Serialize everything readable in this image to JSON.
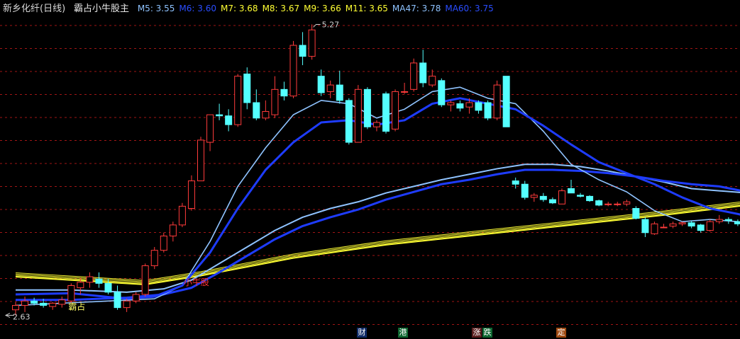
{
  "header": {
    "stock_title": "新乡化纤(日线)",
    "indicator_name": "霸占小牛股主",
    "ma_labels": [
      {
        "text": "M5: 3.55",
        "color": "#8fc3ff"
      },
      {
        "text": "M6: 3.60",
        "color": "#2a4dff"
      },
      {
        "text": "M7: 3.68",
        "color": "#ffff33"
      },
      {
        "text": "M8: 3.67",
        "color": "#ffff33"
      },
      {
        "text": "M9: 3.66",
        "color": "#ffff33"
      },
      {
        "text": "M11: 3.65",
        "color": "#ffff33"
      },
      {
        "text": "MA47: 3.78",
        "color": "#8fc3ff"
      },
      {
        "text": "MA60: 3.75",
        "color": "#2a4dff"
      }
    ]
  },
  "chart_data": {
    "type": "candlestick",
    "ylim": [
      2.55,
      5.35
    ],
    "high_label": "5.27",
    "low_label": "2.63",
    "annotations": [
      {
        "text": "霸占",
        "color": "#ffff66"
      },
      {
        "text": "小牛股",
        "color": "#ff3333"
      }
    ],
    "colors": {
      "up": "#ff3b3b",
      "down": "#54ffff",
      "ma_light": "#8fc3ff",
      "ma_dark": "#1e3cff",
      "ribbon": "#ffff33"
    },
    "candles": [
      [
        2.68,
        2.75,
        2.63,
        2.72
      ],
      [
        2.72,
        2.8,
        2.66,
        2.76
      ],
      [
        2.76,
        2.79,
        2.72,
        2.74
      ],
      [
        2.74,
        2.78,
        2.7,
        2.72
      ],
      [
        2.71,
        2.75,
        2.68,
        2.74
      ],
      [
        2.73,
        2.8,
        2.7,
        2.77
      ],
      [
        2.76,
        2.92,
        2.74,
        2.9
      ],
      [
        2.88,
        2.97,
        2.82,
        2.93
      ],
      [
        2.93,
        3.02,
        2.88,
        2.98
      ],
      [
        2.96,
        3.02,
        2.88,
        2.92
      ],
      [
        2.92,
        2.96,
        2.82,
        2.84
      ],
      [
        2.84,
        2.9,
        2.68,
        2.7
      ],
      [
        2.7,
        2.78,
        2.66,
        2.76
      ],
      [
        2.76,
        2.84,
        2.74,
        2.82
      ],
      [
        2.82,
        3.1,
        2.8,
        3.08
      ],
      [
        3.08,
        3.25,
        3.05,
        3.22
      ],
      [
        3.22,
        3.38,
        3.2,
        3.35
      ],
      [
        3.35,
        3.48,
        3.3,
        3.45
      ],
      [
        3.45,
        3.65,
        3.43,
        3.62
      ],
      [
        3.6,
        3.9,
        3.58,
        3.85
      ],
      [
        3.85,
        4.25,
        3.85,
        4.22
      ],
      [
        4.2,
        4.45,
        4.12,
        4.45
      ],
      [
        4.45,
        4.55,
        4.4,
        4.44
      ],
      [
        4.44,
        4.5,
        4.3,
        4.36
      ],
      [
        4.36,
        4.82,
        4.34,
        4.8
      ],
      [
        4.82,
        4.88,
        4.5,
        4.56
      ],
      [
        4.56,
        4.68,
        4.4,
        4.42
      ],
      [
        4.42,
        4.58,
        4.4,
        4.48
      ],
      [
        4.45,
        4.8,
        4.42,
        4.68
      ],
      [
        4.68,
        4.75,
        4.58,
        4.62
      ],
      [
        4.62,
        5.12,
        4.6,
        5.08
      ],
      [
        5.08,
        5.2,
        4.9,
        4.98
      ],
      [
        4.98,
        5.27,
        4.95,
        5.22
      ],
      [
        4.8,
        4.86,
        4.62,
        4.65
      ],
      [
        4.66,
        4.76,
        4.6,
        4.72
      ],
      [
        4.72,
        4.85,
        4.55,
        4.58
      ],
      [
        4.58,
        4.6,
        4.18,
        4.2
      ],
      [
        4.2,
        4.72,
        4.2,
        4.68
      ],
      [
        4.68,
        4.7,
        4.32,
        4.34
      ],
      [
        4.34,
        4.4,
        4.3,
        4.38
      ],
      [
        4.64,
        4.66,
        4.28,
        4.3
      ],
      [
        4.32,
        4.68,
        4.3,
        4.66
      ],
      [
        4.66,
        4.74,
        4.64,
        4.66
      ],
      [
        4.68,
        4.96,
        4.66,
        4.92
      ],
      [
        4.92,
        5.04,
        4.7,
        4.74
      ],
      [
        4.72,
        4.86,
        4.7,
        4.8
      ],
      [
        4.76,
        4.78,
        4.52,
        4.54
      ],
      [
        4.54,
        4.58,
        4.48,
        4.56
      ],
      [
        4.55,
        4.58,
        4.48,
        4.51
      ],
      [
        4.52,
        4.6,
        4.46,
        4.56
      ],
      [
        4.56,
        4.58,
        4.46,
        4.49
      ],
      [
        4.56,
        4.58,
        4.4,
        4.42
      ],
      [
        4.42,
        4.76,
        4.4,
        4.72
      ],
      [
        4.8,
        4.8,
        4.34,
        4.34
      ],
      [
        3.85,
        3.88,
        3.78,
        3.82
      ],
      [
        3.82,
        3.85,
        3.68,
        3.7
      ],
      [
        3.7,
        3.74,
        3.66,
        3.72
      ],
      [
        3.71,
        3.74,
        3.66,
        3.68
      ],
      [
        3.68,
        3.7,
        3.64,
        3.65
      ],
      [
        3.64,
        3.78,
        3.64,
        3.76
      ],
      [
        3.78,
        3.86,
        3.74,
        3.74
      ],
      [
        3.72,
        3.74,
        3.7,
        3.71
      ],
      [
        3.71,
        3.72,
        3.66,
        3.67
      ],
      [
        3.67,
        3.68,
        3.62,
        3.63
      ],
      [
        3.64,
        3.66,
        3.62,
        3.64
      ],
      [
        3.64,
        3.66,
        3.62,
        3.64
      ],
      [
        3.64,
        3.68,
        3.62,
        3.66
      ],
      [
        3.6,
        3.62,
        3.5,
        3.51
      ],
      [
        3.5,
        3.52,
        3.34,
        3.38
      ],
      [
        3.37,
        3.48,
        3.36,
        3.46
      ],
      [
        3.43,
        3.46,
        3.42,
        3.43
      ],
      [
        3.44,
        3.48,
        3.42,
        3.46
      ],
      [
        3.46,
        3.48,
        3.44,
        3.47
      ],
      [
        3.47,
        3.49,
        3.42,
        3.44
      ],
      [
        3.45,
        3.46,
        3.38,
        3.4
      ],
      [
        3.4,
        3.5,
        3.39,
        3.48
      ],
      [
        3.48,
        3.54,
        3.46,
        3.5
      ],
      [
        3.5,
        3.52,
        3.46,
        3.49
      ],
      [
        3.48,
        3.5,
        3.44,
        3.46
      ],
      [
        3.44,
        3.48,
        3.42,
        3.46
      ]
    ],
    "ma_light_short": [
      [
        0,
        2.72
      ],
      [
        15,
        2.78
      ],
      [
        18,
        2.9
      ],
      [
        21,
        3.3
      ],
      [
        24,
        3.8
      ],
      [
        27,
        4.15
      ],
      [
        30,
        4.45
      ],
      [
        33,
        4.58
      ],
      [
        36,
        4.55
      ],
      [
        39,
        4.42
      ],
      [
        42,
        4.5
      ],
      [
        45,
        4.66
      ],
      [
        48,
        4.7
      ],
      [
        51,
        4.6
      ],
      [
        54,
        4.55
      ],
      [
        57,
        4.3
      ],
      [
        60,
        4.0
      ],
      [
        63,
        3.86
      ],
      [
        66,
        3.75
      ],
      [
        69,
        3.58
      ],
      [
        72,
        3.48
      ],
      [
        75,
        3.5
      ],
      [
        78,
        3.48
      ],
      [
        79,
        3.47
      ]
    ],
    "ma_dark_short": [
      [
        0,
        2.82
      ],
      [
        6,
        2.83
      ],
      [
        12,
        2.78
      ],
      [
        15,
        2.8
      ],
      [
        18,
        2.9
      ],
      [
        21,
        3.2
      ],
      [
        24,
        3.6
      ],
      [
        27,
        3.95
      ],
      [
        30,
        4.2
      ],
      [
        33,
        4.38
      ],
      [
        36,
        4.4
      ],
      [
        39,
        4.36
      ],
      [
        42,
        4.4
      ],
      [
        45,
        4.55
      ],
      [
        48,
        4.6
      ],
      [
        51,
        4.55
      ],
      [
        54,
        4.5
      ],
      [
        57,
        4.35
      ],
      [
        60,
        4.18
      ],
      [
        63,
        4.02
      ],
      [
        66,
        3.92
      ],
      [
        69,
        3.82
      ],
      [
        72,
        3.7
      ],
      [
        75,
        3.6
      ],
      [
        78,
        3.55
      ],
      [
        79,
        3.53
      ]
    ],
    "ma_light_long": [
      [
        0,
        2.86
      ],
      [
        6,
        2.86
      ],
      [
        12,
        2.84
      ],
      [
        16,
        2.87
      ],
      [
        19,
        2.95
      ],
      [
        22,
        3.1
      ],
      [
        25,
        3.25
      ],
      [
        28,
        3.4
      ],
      [
        31,
        3.52
      ],
      [
        34,
        3.6
      ],
      [
        37,
        3.66
      ],
      [
        40,
        3.74
      ],
      [
        43,
        3.8
      ],
      [
        46,
        3.86
      ],
      [
        49,
        3.91
      ],
      [
        52,
        3.96
      ],
      [
        55,
        4.0
      ],
      [
        58,
        4.0
      ],
      [
        61,
        3.98
      ],
      [
        64,
        3.94
      ],
      [
        67,
        3.89
      ],
      [
        70,
        3.84
      ],
      [
        73,
        3.78
      ],
      [
        76,
        3.76
      ],
      [
        79,
        3.74
      ]
    ],
    "ma_dark_long": [
      [
        0,
        2.77
      ],
      [
        6,
        2.77
      ],
      [
        12,
        2.79
      ],
      [
        16,
        2.82
      ],
      [
        19,
        2.88
      ],
      [
        22,
        3.02
      ],
      [
        25,
        3.17
      ],
      [
        28,
        3.32
      ],
      [
        31,
        3.44
      ],
      [
        34,
        3.52
      ],
      [
        37,
        3.59
      ],
      [
        40,
        3.68
      ],
      [
        43,
        3.75
      ],
      [
        46,
        3.82
      ],
      [
        49,
        3.86
      ],
      [
        52,
        3.91
      ],
      [
        55,
        3.95
      ],
      [
        58,
        3.95
      ],
      [
        61,
        3.94
      ],
      [
        64,
        3.92
      ],
      [
        67,
        3.89
      ],
      [
        70,
        3.85
      ],
      [
        73,
        3.82
      ],
      [
        76,
        3.8
      ],
      [
        79,
        3.75
      ]
    ],
    "ribbon": [
      [
        0,
        2.98
      ],
      [
        10,
        2.93
      ],
      [
        14,
        2.91
      ],
      [
        20,
        2.99
      ],
      [
        30,
        3.15
      ],
      [
        40,
        3.27
      ],
      [
        50,
        3.36
      ],
      [
        60,
        3.45
      ],
      [
        70,
        3.54
      ],
      [
        79,
        3.63
      ]
    ],
    "event_markers": [
      {
        "text": "财",
        "bg": "#0e2a66",
        "color": "#ffffff"
      },
      {
        "text": "港",
        "bg": "#0e6630",
        "color": "#ffffff"
      },
      {
        "text": "涨",
        "bg": "#5a1e1e",
        "color": "#ffffff"
      },
      {
        "text": "跌",
        "bg": "#0e6630",
        "color": "#ffffff"
      },
      {
        "text": "定",
        "bg": "#a04a12",
        "color": "#ffffff"
      }
    ]
  }
}
